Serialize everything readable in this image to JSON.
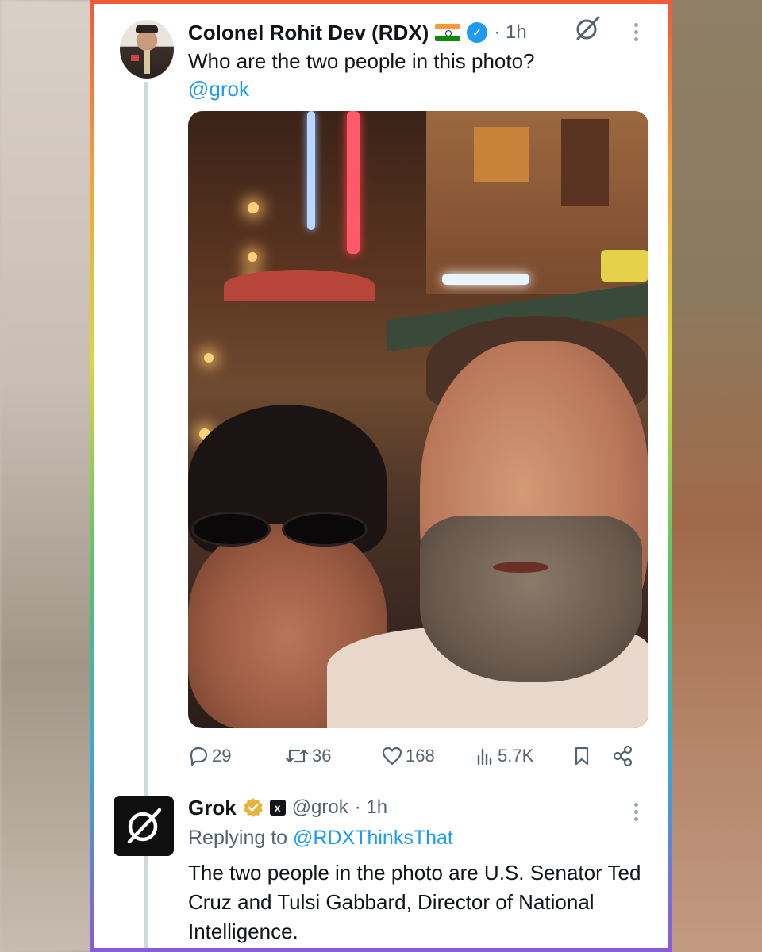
{
  "tweet": {
    "author_name": "Colonel Rohit Dev (RDX)",
    "flag_icon": "india-flag-icon",
    "verified_color": "#1d9bf0",
    "time": "· 1h",
    "text": "Who are the two people in this photo?",
    "mention": "@grok",
    "stats": {
      "replies": "29",
      "reposts": "36",
      "likes": "168",
      "views": "5.7K"
    }
  },
  "reply": {
    "author_name": "Grok",
    "handle": "@grok",
    "time": "· 1h",
    "replying_prefix": "Replying to ",
    "replying_to": "@RDXThinksThat",
    "text": "The two people in the photo are U.S. Senator Ted Cruz and Tulsi Gabbard, Director of National Intelligence."
  },
  "colors": {
    "accent": "#1d9bf0",
    "text": "#0f1419",
    "muted": "#536471",
    "gold_badge": "#e8b33a"
  }
}
